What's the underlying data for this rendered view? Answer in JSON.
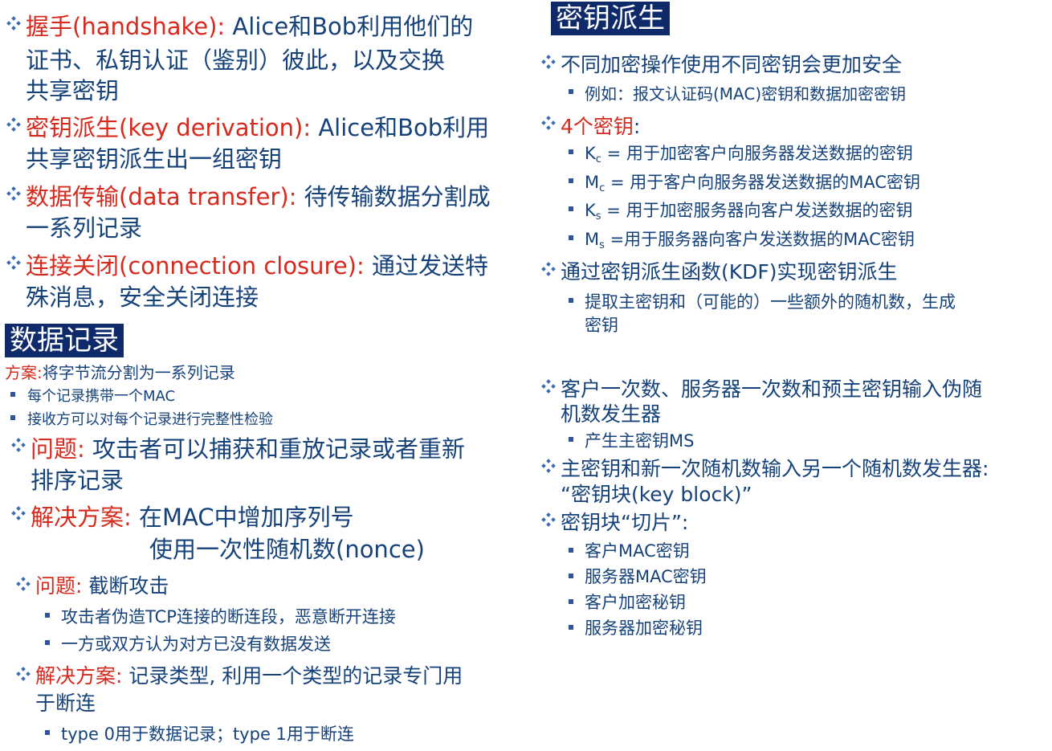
{
  "left": {
    "handshake": {
      "term": "握手(handshake):",
      "line1": " Alice和Bob利用他们的",
      "line2": "证书、私钥认证（鉴别）彼此，以及交换",
      "line3": "共享密钥"
    },
    "key_derivation": {
      "term": "密钥派生(key derivation):",
      "line1": " Alice和Bob利用",
      "line2": "共享密钥派生出一组密钥"
    },
    "data_transfer": {
      "term": "数据传输(data transfer):",
      "line1": " 待传输数据分割成",
      "line2": "一系列记录"
    },
    "connection_closure": {
      "term": "连接关闭(connection closure):",
      "line1": " 通过发送特",
      "line2": "殊消息，安全关闭连接"
    },
    "section_title": "数据记录",
    "scheme": {
      "label": "方案:",
      "text": "将字节流分割为一系列记录",
      "bullets": [
        "每个记录携带一个MAC",
        "接收方可以对每个记录进行完整性检验"
      ]
    },
    "problem1": {
      "label": "问题:",
      "line1": " 攻击者可以捕获和重放记录或者重新",
      "line2": "排序记录"
    },
    "solution1": {
      "label": "解决方案:",
      "line1": " 在MAC中增加序列号",
      "line2": "使用一次性随机数(nonce)"
    },
    "problem2": {
      "label": "问题:",
      "line1": " 截断攻击",
      "bullets": [
        "攻击者伪造TCP连接的断连段，恶意断开连接",
        "一方或双方认为对方已没有数据发送"
      ]
    },
    "solution2": {
      "label": "解决方案:",
      "line1": " 记录类型, 利用一个类型的记录专门用",
      "line2": "于断连",
      "bullets": [
        "type 0用于数据记录；type 1用于断连"
      ]
    }
  },
  "right": {
    "section_title": "密钥派生",
    "p1": "不同加密操作使用不同密钥会更加安全",
    "p1_bullet": "例如：报文认证码(MAC)密钥和数据加密密钥",
    "p2_label": "4个密钥",
    "p2_colon": ":",
    "keys": [
      {
        "sym": "K",
        "sub": "c",
        "text": " = 用于加密客户向服务器发送数据的密钥"
      },
      {
        "sym": "M",
        "sub": "c",
        "text": " = 用于客户向服务器发送数据的MAC密钥"
      },
      {
        "sym": "K",
        "sub": "s",
        "text": " = 用于加密服务器向客户发送数据的密钥"
      },
      {
        "sym": "M",
        "sub": "s",
        "text": " =用于服务器向客户发送数据的MAC密钥"
      }
    ],
    "p3": "通过密钥派生函数(KDF)实现密钥派生",
    "p3_bullet_line1": "提取主密钥和（可能的）一些额外的随机数，生成",
    "p3_bullet_line2": "密钥",
    "p4_line1": "客户一次数、服务器一次数和预主密钥输入伪随",
    "p4_line2": "机数发生器",
    "p4_bullet": "产生主密钥MS",
    "p5_line1": "主密钥和新一次随机数输入另一个随机数发生器:",
    "p5_line2": "“密钥块(key block)”",
    "p6": "密钥块“切片”:",
    "p6_bullets": [
      "客户MAC密钥",
      "服务器MAC密钥",
      "客户加密秘钥",
      "服务器加密秘钥"
    ]
  }
}
